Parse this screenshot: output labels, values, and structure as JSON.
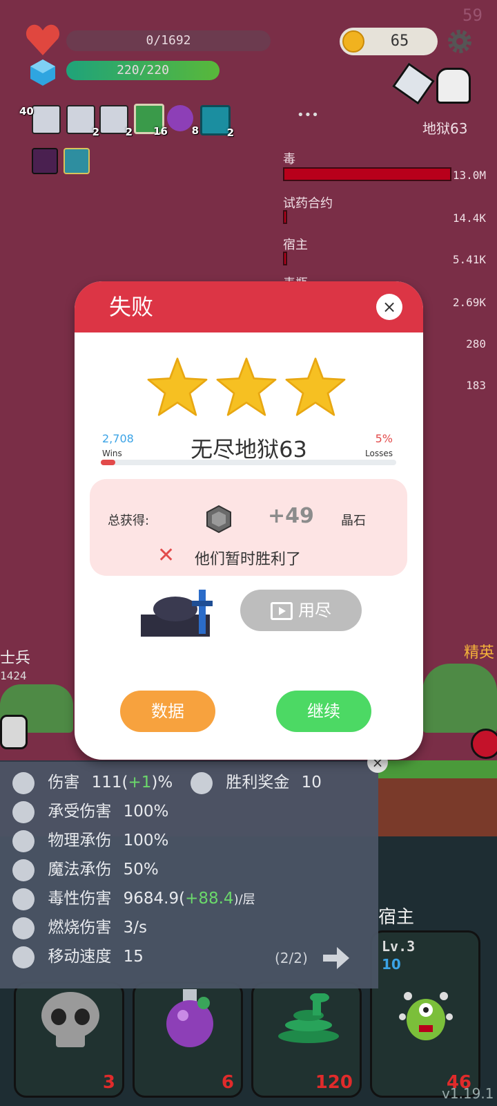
{
  "fps": "59",
  "hud": {
    "hp_text": "0/1692",
    "hp_fraction": 0,
    "shield_text": "220/220",
    "shield_fraction": 1,
    "coins": "65"
  },
  "items": [
    {
      "name": "scroll",
      "count": "40"
    },
    {
      "name": "scroll",
      "count": "2"
    },
    {
      "name": "scroll",
      "count": "2"
    },
    {
      "name": "book",
      "count": "16"
    },
    {
      "name": "potion",
      "count": "8"
    },
    {
      "name": "spiral",
      "count": "2"
    }
  ],
  "more": "•••",
  "level_label": "地狱63",
  "damage_list": [
    {
      "name": "毒",
      "value": "13.0M"
    },
    {
      "name": "试药合约",
      "value": "14.4K"
    },
    {
      "name": "宿主",
      "value": "5.41K"
    },
    {
      "name": "毒瓶",
      "value": "2.69K"
    },
    {
      "name": "",
      "value": "280"
    },
    {
      "name": "",
      "value": "183"
    }
  ],
  "modal": {
    "title": "失败",
    "close": "×",
    "stars": 3,
    "wins_num": "2,708",
    "wins_label": "Wins",
    "stage": "无尽地狱63",
    "losses_num": "5%",
    "losses_label": "Losses",
    "loss_fraction": 0.05,
    "total_label": "总获得:",
    "gain": "+49",
    "gem_label": "晶石",
    "result_text": "他们暂时胜利了",
    "ad_label": "用尽",
    "stats_btn": "数据",
    "continue_btn": "继续"
  },
  "field": {
    "left_name": "士兵",
    "left_num": "1424",
    "right_name": "精英",
    "host_name": "宿主"
  },
  "stats": {
    "close": "×",
    "rows": [
      {
        "icon": "axe-icon",
        "label": "伤害",
        "value": "111(",
        "extra": "+1",
        "suffix": ")%"
      },
      {
        "icon": "target-icon",
        "label": "承受伤害",
        "value": "100%",
        "extra": "",
        "suffix": ""
      },
      {
        "icon": "shield-icon",
        "label": "物理承伤",
        "value": "100%",
        "extra": "",
        "suffix": ""
      },
      {
        "icon": "heart-shield-icon",
        "label": "魔法承伤",
        "value": "50%",
        "extra": "",
        "suffix": ""
      },
      {
        "icon": "skull-icon",
        "label": "毒性伤害",
        "value": "9684.9(",
        "extra": "+88.4",
        "suffix": ")/层"
      },
      {
        "icon": "fire-icon",
        "label": "燃烧伤害",
        "value": "3/s",
        "extra": "",
        "suffix": ""
      },
      {
        "icon": "boot-icon",
        "label": "移动速度",
        "value": "15",
        "extra": "",
        "suffix": ""
      }
    ],
    "bonus_label": "胜利奖金",
    "bonus_value": "10",
    "page": "(2/2)"
  },
  "cards": [
    {
      "name": "skull",
      "count": "3"
    },
    {
      "name": "potion",
      "count": "6"
    },
    {
      "name": "snake",
      "count": "120"
    },
    {
      "name": "host",
      "count": "46",
      "level": "Lv.3",
      "sub": "10"
    }
  ],
  "version": "v1.19.1",
  "colors": {
    "accent": "#dc3545",
    "stats_btn": "#f7a23e",
    "continue_btn": "#4cd964",
    "ad_btn": "#bdbdbd"
  }
}
